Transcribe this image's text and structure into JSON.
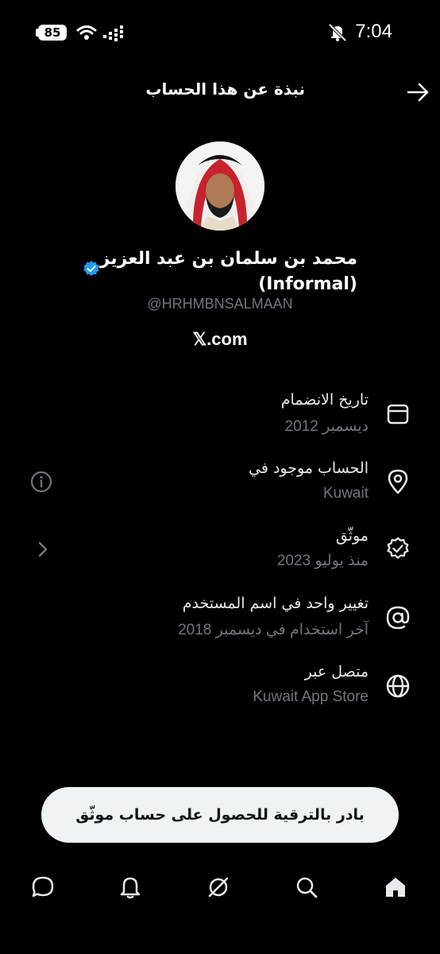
{
  "status_bar": {
    "battery": "85",
    "time": "7:04"
  },
  "header": {
    "title": "نبذة عن هذا الحساب"
  },
  "profile": {
    "name_line1": "محمد بن سلمان بن عبد العزيز",
    "name_line2": "(Informal)",
    "handle": "@HRHMBNSALMAAN",
    "source": "𝕏.com"
  },
  "rows": [
    {
      "title": "تاريخ الانضمام",
      "subtitle": "ديسمبر 2012",
      "icon": "calendar-icon"
    },
    {
      "title": "الحساب موجود في",
      "subtitle": "Kuwait",
      "icon": "location-pin-icon"
    },
    {
      "title": "موثّق",
      "subtitle": "منذ يوليو 2023",
      "icon": "verified-check-icon"
    },
    {
      "title": "تغيير واحد في اسم المستخدم",
      "subtitle": "آخر استخدام في ديسمبر 2018",
      "icon": "at-sign-icon"
    },
    {
      "title": "متصل عبر",
      "subtitle": "Kuwait App Store",
      "icon": "globe-icon"
    }
  ],
  "upgrade_button": {
    "label": "بادر بالترقية للحصول على حساب موثّق"
  },
  "bottom_nav": [
    "home-icon",
    "search-icon",
    "grok-icon",
    "notifications-icon",
    "messages-icon"
  ],
  "colors": {
    "background": "#000000",
    "muted": "#71767b",
    "verified_blue": "#1d9bf0",
    "button_bg": "#eff3f4"
  }
}
